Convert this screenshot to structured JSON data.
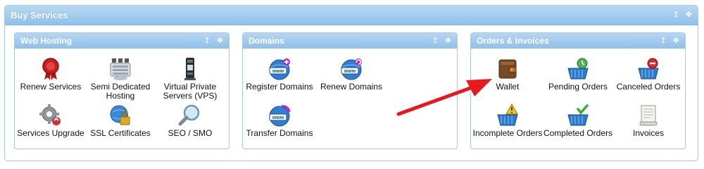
{
  "outer": {
    "title": "Buy Services"
  },
  "panels": [
    {
      "title": "Web Hosting",
      "items": [
        {
          "label": "Renew Services",
          "icon": "ribbon-seal-icon"
        },
        {
          "label": "Semi Dedicated Hosting",
          "icon": "server-rack-icon"
        },
        {
          "label": "Virtual Private Servers (VPS)",
          "icon": "vps-server-icon"
        },
        {
          "label": "Services Upgrade",
          "icon": "gear-upgrade-icon"
        },
        {
          "label": "SSL Certificates",
          "icon": "ssl-lock-globe-icon"
        },
        {
          "label": "SEO / SMO",
          "icon": "magnifier-icon"
        }
      ]
    },
    {
      "title": "Domains",
      "items": [
        {
          "label": "Register Domains",
          "icon": "www-globe-plus-icon"
        },
        {
          "label": "Renew Domains",
          "icon": "www-globe-renew-icon"
        },
        {
          "label": "Transfer Domains",
          "icon": "www-transfer-icon"
        }
      ]
    },
    {
      "title": "Orders & Invoices",
      "items": [
        {
          "label": "Wallet",
          "icon": "wallet-icon"
        },
        {
          "label": "Pending Orders",
          "icon": "basket-clock-icon"
        },
        {
          "label": "Canceled Orders",
          "icon": "basket-cancel-icon"
        },
        {
          "label": "Incomplete Orders",
          "icon": "basket-warning-icon"
        },
        {
          "label": "Completed Orders",
          "icon": "basket-check-icon"
        },
        {
          "label": "Invoices",
          "icon": "invoice-icon"
        }
      ]
    }
  ],
  "header_icons": {
    "pin": "↥",
    "move": "✥"
  },
  "colors": {
    "header_blue": "#9cc9ee",
    "arrow_red": "#e8191c"
  }
}
